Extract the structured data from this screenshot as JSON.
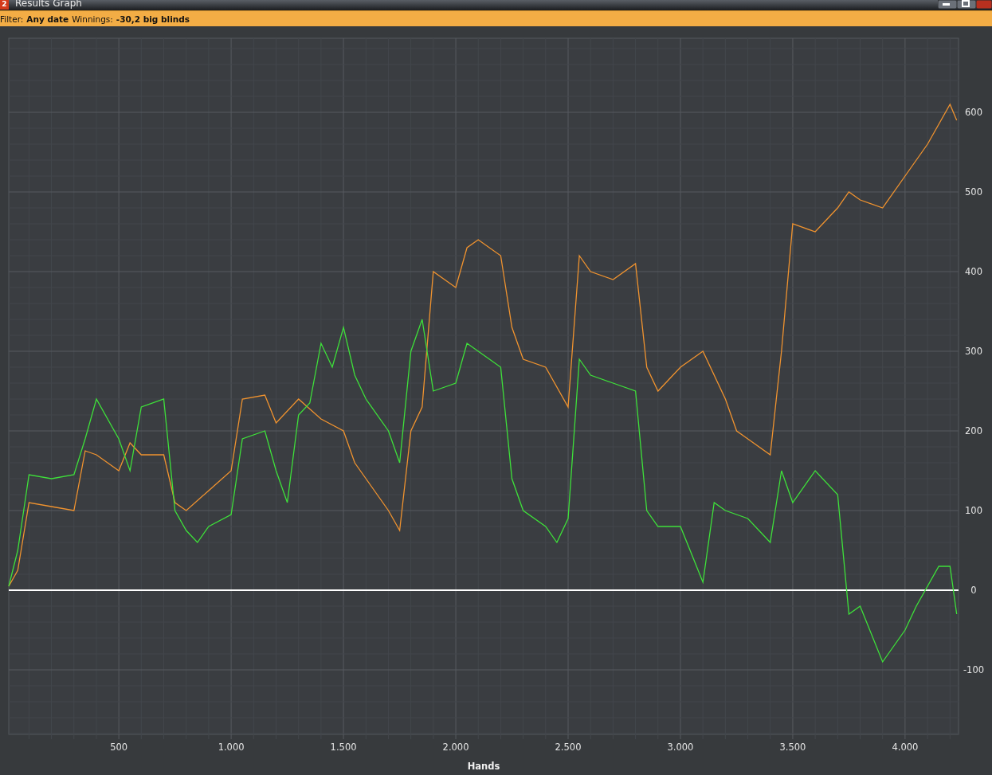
{
  "window": {
    "title": "Results Graph",
    "app_icon_label": "2"
  },
  "window_controls": [
    {
      "kind": "minimize"
    },
    {
      "kind": "maximize"
    },
    {
      "kind": "close"
    }
  ],
  "filter_bar": {
    "label": "Filter:",
    "date_filter": "Any date",
    "winnings_label": "Winnings:",
    "winnings_value": "-30,2 big blinds"
  },
  "chart": {
    "chart_data": {
      "type": "line",
      "xlabel": "Hands",
      "xlim": [
        10,
        4238
      ],
      "ylim": [
        -181,
        693
      ],
      "xticks": [
        {
          "value": 500,
          "label": "500"
        },
        {
          "value": 1000,
          "label": "1.000"
        },
        {
          "value": 1500,
          "label": "1.500"
        },
        {
          "value": 2000,
          "label": "2.000"
        },
        {
          "value": 2500,
          "label": "2.500"
        },
        {
          "value": 3000,
          "label": "3.000"
        },
        {
          "value": 3500,
          "label": "3.500"
        },
        {
          "value": 4000,
          "label": "4.000"
        }
      ],
      "yticks": [
        -100,
        0,
        100,
        200,
        300,
        400,
        500,
        600
      ],
      "series": [
        {
          "color": "#f0932f",
          "x": [
            10,
            50,
            100,
            200,
            300,
            350,
            400,
            500,
            550,
            600,
            700,
            750,
            800,
            900,
            1000,
            1050,
            1150,
            1200,
            1300,
            1400,
            1500,
            1550,
            1600,
            1700,
            1750,
            1800,
            1850,
            1900,
            2000,
            2050,
            2100,
            2200,
            2250,
            2300,
            2400,
            2500,
            2550,
            2600,
            2700,
            2800,
            2850,
            2900,
            3000,
            3100,
            3200,
            3250,
            3300,
            3400,
            3450,
            3500,
            3600,
            3700,
            3750,
            3800,
            3900,
            4000,
            4100,
            4200,
            4230
          ],
          "values": [
            5,
            25,
            110,
            105,
            100,
            175,
            170,
            150,
            185,
            170,
            170,
            110,
            100,
            125,
            150,
            240,
            245,
            210,
            240,
            215,
            200,
            160,
            140,
            100,
            75,
            200,
            230,
            400,
            380,
            430,
            440,
            420,
            330,
            290,
            280,
            230,
            420,
            400,
            390,
            410,
            280,
            250,
            280,
            300,
            240,
            200,
            190,
            170,
            300,
            460,
            450,
            480,
            500,
            490,
            480,
            520,
            560,
            610,
            590
          ]
        },
        {
          "color": "#3ee03a",
          "x": [
            10,
            50,
            100,
            200,
            300,
            350,
            400,
            500,
            550,
            600,
            700,
            750,
            800,
            850,
            900,
            1000,
            1050,
            1150,
            1200,
            1250,
            1300,
            1350,
            1400,
            1450,
            1500,
            1550,
            1600,
            1700,
            1750,
            1800,
            1850,
            1900,
            2000,
            2050,
            2150,
            2200,
            2250,
            2300,
            2400,
            2450,
            2500,
            2550,
            2600,
            2700,
            2800,
            2850,
            2900,
            3000,
            3100,
            3150,
            3200,
            3300,
            3400,
            3450,
            3500,
            3600,
            3700,
            3750,
            3800,
            3900,
            4000,
            4050,
            4150,
            4200,
            4230
          ],
          "values": [
            5,
            50,
            145,
            140,
            145,
            190,
            240,
            190,
            150,
            230,
            240,
            100,
            75,
            60,
            80,
            95,
            190,
            200,
            150,
            110,
            220,
            235,
            310,
            280,
            330,
            270,
            240,
            200,
            160,
            300,
            340,
            250,
            260,
            310,
            290,
            280,
            140,
            100,
            80,
            60,
            90,
            290,
            270,
            260,
            250,
            100,
            80,
            80,
            10,
            110,
            100,
            90,
            60,
            150,
            110,
            150,
            120,
            -30,
            -20,
            -90,
            -50,
            -20,
            30,
            30,
            -30
          ]
        }
      ],
      "grid": true,
      "ref_lines": [
        {
          "axis": "y",
          "value": 0,
          "color": "#ffffff"
        }
      ]
    }
  }
}
